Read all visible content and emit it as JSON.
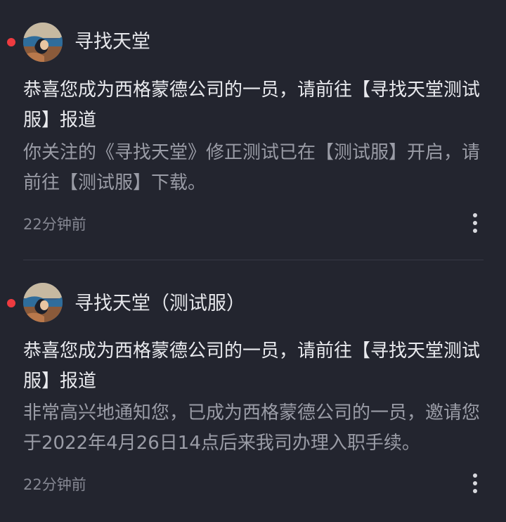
{
  "colors": {
    "background": "#23252f",
    "unread_dot": "#ee3b40",
    "title_text": "#e9eaee",
    "body_text": "#9a9ca6",
    "time_text": "#868893"
  },
  "messages": [
    {
      "unread": true,
      "avatar_icon": "avatar-image",
      "sender": "寻找天堂",
      "title": "恭喜您成为西格蒙德公司的一员，请前往【寻找天堂测试服】报道",
      "body": "你关注的《寻找天堂》修正测试已在【测试服】开启，请前往【测试服】下载。",
      "time": "22分钟前",
      "more_icon": "more-vertical-icon"
    },
    {
      "unread": true,
      "avatar_icon": "avatar-image",
      "sender": "寻找天堂（测试服）",
      "title": "恭喜您成为西格蒙德公司的一员，请前往【寻找天堂测试服】报道",
      "body": "非常高兴地通知您，已成为西格蒙德公司的一员，邀请您于2022年4月26日14点后来我司办理入职手续。",
      "time": "22分钟前",
      "more_icon": "more-vertical-icon"
    }
  ]
}
